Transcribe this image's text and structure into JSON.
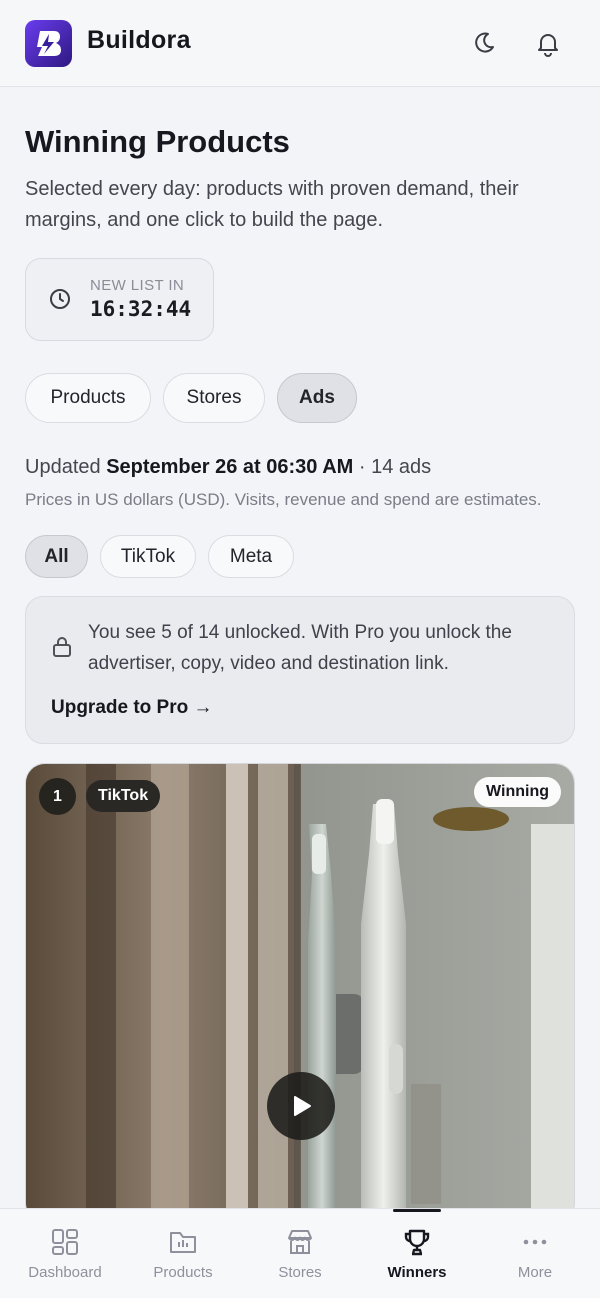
{
  "app": {
    "brand": "Buildora"
  },
  "header": {
    "icons": [
      "moon-icon",
      "bell-icon"
    ]
  },
  "page": {
    "title": "Winning Products",
    "subtitle": "Selected every day: products with proven demand, their margins, and one click to build the page."
  },
  "timer": {
    "label": "NEW LIST IN",
    "value": "16:32:44"
  },
  "tabs": [
    {
      "label": "Products",
      "active": false
    },
    {
      "label": "Stores",
      "active": false
    },
    {
      "label": "Ads",
      "active": true
    }
  ],
  "status": {
    "prefix": "Updated",
    "date": "September 26 at 06:30 AM",
    "count": "· 14 ads",
    "note": "Prices in US dollars (USD). Visits, revenue and spend are estimates."
  },
  "filters": [
    {
      "label": "All",
      "active": true
    },
    {
      "label": "TikTok",
      "active": false
    },
    {
      "label": "Meta",
      "active": false
    }
  ],
  "lock_notice": {
    "text": "You see 5 of 14 unlocked. With Pro you unlock the advertiser, copy, video and destination link.",
    "cta": "Upgrade to Pro →"
  },
  "ad_card": {
    "rank": "1",
    "platform": "TikTok",
    "badge": "Winning"
  },
  "bottom_nav": [
    {
      "label": "Dashboard",
      "icon": "grid-icon",
      "active": false
    },
    {
      "label": "Products",
      "icon": "folder-icon",
      "active": false
    },
    {
      "label": "Stores",
      "icon": "store-icon",
      "active": false
    },
    {
      "label": "Winners",
      "icon": "trophy-icon",
      "active": true
    },
    {
      "label": "More",
      "icon": "more-icon",
      "active": false
    }
  ],
  "colors": {
    "accent": "#5a34e0",
    "background": "#f3f4f7",
    "text": "#17181f"
  }
}
